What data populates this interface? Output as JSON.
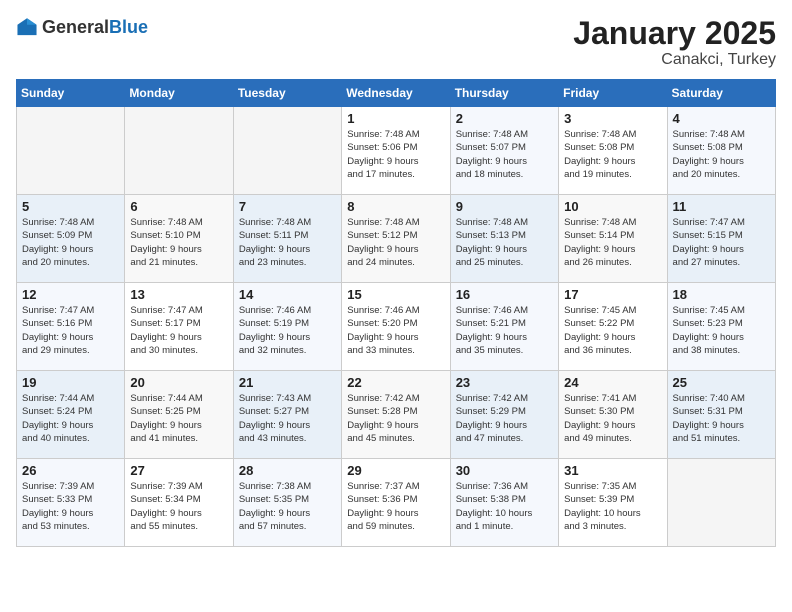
{
  "header": {
    "logo_general": "General",
    "logo_blue": "Blue",
    "month_title": "January 2025",
    "location": "Canakci, Turkey"
  },
  "weekdays": [
    "Sunday",
    "Monday",
    "Tuesday",
    "Wednesday",
    "Thursday",
    "Friday",
    "Saturday"
  ],
  "weeks": [
    [
      {
        "day": "",
        "info": ""
      },
      {
        "day": "",
        "info": ""
      },
      {
        "day": "",
        "info": ""
      },
      {
        "day": "1",
        "info": "Sunrise: 7:48 AM\nSunset: 5:06 PM\nDaylight: 9 hours\nand 17 minutes."
      },
      {
        "day": "2",
        "info": "Sunrise: 7:48 AM\nSunset: 5:07 PM\nDaylight: 9 hours\nand 18 minutes."
      },
      {
        "day": "3",
        "info": "Sunrise: 7:48 AM\nSunset: 5:08 PM\nDaylight: 9 hours\nand 19 minutes."
      },
      {
        "day": "4",
        "info": "Sunrise: 7:48 AM\nSunset: 5:08 PM\nDaylight: 9 hours\nand 20 minutes."
      }
    ],
    [
      {
        "day": "5",
        "info": "Sunrise: 7:48 AM\nSunset: 5:09 PM\nDaylight: 9 hours\nand 20 minutes."
      },
      {
        "day": "6",
        "info": "Sunrise: 7:48 AM\nSunset: 5:10 PM\nDaylight: 9 hours\nand 21 minutes."
      },
      {
        "day": "7",
        "info": "Sunrise: 7:48 AM\nSunset: 5:11 PM\nDaylight: 9 hours\nand 23 minutes."
      },
      {
        "day": "8",
        "info": "Sunrise: 7:48 AM\nSunset: 5:12 PM\nDaylight: 9 hours\nand 24 minutes."
      },
      {
        "day": "9",
        "info": "Sunrise: 7:48 AM\nSunset: 5:13 PM\nDaylight: 9 hours\nand 25 minutes."
      },
      {
        "day": "10",
        "info": "Sunrise: 7:48 AM\nSunset: 5:14 PM\nDaylight: 9 hours\nand 26 minutes."
      },
      {
        "day": "11",
        "info": "Sunrise: 7:47 AM\nSunset: 5:15 PM\nDaylight: 9 hours\nand 27 minutes."
      }
    ],
    [
      {
        "day": "12",
        "info": "Sunrise: 7:47 AM\nSunset: 5:16 PM\nDaylight: 9 hours\nand 29 minutes."
      },
      {
        "day": "13",
        "info": "Sunrise: 7:47 AM\nSunset: 5:17 PM\nDaylight: 9 hours\nand 30 minutes."
      },
      {
        "day": "14",
        "info": "Sunrise: 7:46 AM\nSunset: 5:19 PM\nDaylight: 9 hours\nand 32 minutes."
      },
      {
        "day": "15",
        "info": "Sunrise: 7:46 AM\nSunset: 5:20 PM\nDaylight: 9 hours\nand 33 minutes."
      },
      {
        "day": "16",
        "info": "Sunrise: 7:46 AM\nSunset: 5:21 PM\nDaylight: 9 hours\nand 35 minutes."
      },
      {
        "day": "17",
        "info": "Sunrise: 7:45 AM\nSunset: 5:22 PM\nDaylight: 9 hours\nand 36 minutes."
      },
      {
        "day": "18",
        "info": "Sunrise: 7:45 AM\nSunset: 5:23 PM\nDaylight: 9 hours\nand 38 minutes."
      }
    ],
    [
      {
        "day": "19",
        "info": "Sunrise: 7:44 AM\nSunset: 5:24 PM\nDaylight: 9 hours\nand 40 minutes."
      },
      {
        "day": "20",
        "info": "Sunrise: 7:44 AM\nSunset: 5:25 PM\nDaylight: 9 hours\nand 41 minutes."
      },
      {
        "day": "21",
        "info": "Sunrise: 7:43 AM\nSunset: 5:27 PM\nDaylight: 9 hours\nand 43 minutes."
      },
      {
        "day": "22",
        "info": "Sunrise: 7:42 AM\nSunset: 5:28 PM\nDaylight: 9 hours\nand 45 minutes."
      },
      {
        "day": "23",
        "info": "Sunrise: 7:42 AM\nSunset: 5:29 PM\nDaylight: 9 hours\nand 47 minutes."
      },
      {
        "day": "24",
        "info": "Sunrise: 7:41 AM\nSunset: 5:30 PM\nDaylight: 9 hours\nand 49 minutes."
      },
      {
        "day": "25",
        "info": "Sunrise: 7:40 AM\nSunset: 5:31 PM\nDaylight: 9 hours\nand 51 minutes."
      }
    ],
    [
      {
        "day": "26",
        "info": "Sunrise: 7:39 AM\nSunset: 5:33 PM\nDaylight: 9 hours\nand 53 minutes."
      },
      {
        "day": "27",
        "info": "Sunrise: 7:39 AM\nSunset: 5:34 PM\nDaylight: 9 hours\nand 55 minutes."
      },
      {
        "day": "28",
        "info": "Sunrise: 7:38 AM\nSunset: 5:35 PM\nDaylight: 9 hours\nand 57 minutes."
      },
      {
        "day": "29",
        "info": "Sunrise: 7:37 AM\nSunset: 5:36 PM\nDaylight: 9 hours\nand 59 minutes."
      },
      {
        "day": "30",
        "info": "Sunrise: 7:36 AM\nSunset: 5:38 PM\nDaylight: 10 hours\nand 1 minute."
      },
      {
        "day": "31",
        "info": "Sunrise: 7:35 AM\nSunset: 5:39 PM\nDaylight: 10 hours\nand 3 minutes."
      },
      {
        "day": "",
        "info": ""
      }
    ]
  ]
}
